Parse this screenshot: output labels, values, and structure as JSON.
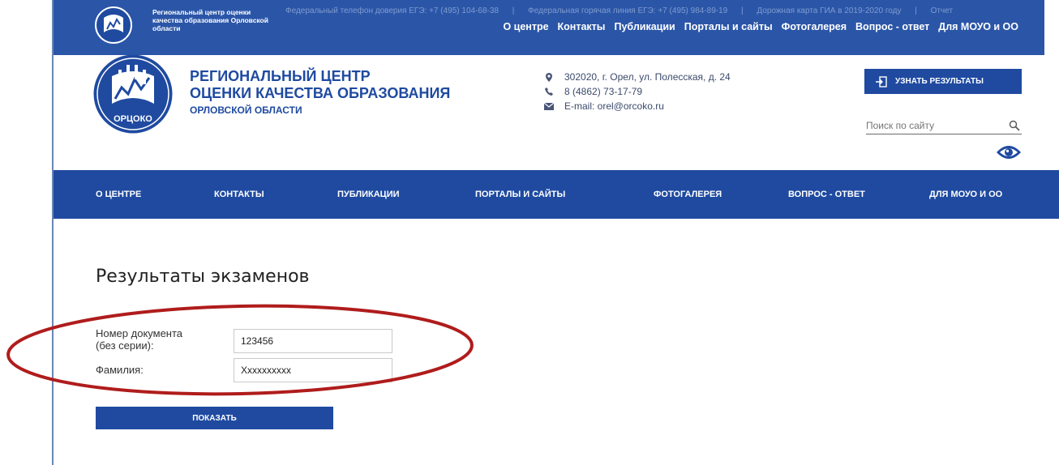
{
  "topbar": {
    "mini_title": "Региональный центр оценки качества образования Орловской области",
    "ticker": [
      "Федеральный телефон доверия ЕГЭ: +7 (495) 104-68-38",
      "|",
      "Федеральная горячая линия ЕГЭ: +7 (495) 984-89-19",
      "|",
      "Дорожная карта ГИА в 2019-2020 году",
      "|",
      "Отчет"
    ],
    "links": [
      "О центре",
      "Контакты",
      "Публикации",
      "Порталы и сайты",
      "Фотогалерея",
      "Вопрос - ответ",
      "Для МОУО и ОО"
    ]
  },
  "header": {
    "logo_text": "ОРЦОКО",
    "org_line1": "РЕГИОНАЛЬНЫЙ ЦЕНТР",
    "org_line2": "ОЦЕНКИ КАЧЕСТВА ОБРАЗОВАНИЯ",
    "org_line3": "ОРЛОВСКОЙ ОБЛАСТИ",
    "address": "302020, г. Орел, ул. Полесская, д. 24",
    "phone": "8 (4862) 73-17-79",
    "email": "E-mail: orel@orcoko.ru",
    "result_button": "УЗНАТЬ РЕЗУЛЬТАТЫ",
    "search_placeholder": "Поиск по сайту"
  },
  "nav": [
    "О ЦЕНТРЕ",
    "КОНТАКТЫ",
    "ПУБЛИКАЦИИ",
    "ПОРТАЛЫ И САЙТЫ",
    "ФОТОГАЛЕРЕЯ",
    "ВОПРОС - ОТВЕТ",
    "ДЛЯ МОУО И ОО"
  ],
  "form": {
    "title": "Результаты экзаменов",
    "doc_label_1": "Номер документа",
    "doc_label_2": "(без серии):",
    "doc_value": "123456",
    "surname_label": "Фамилия:",
    "surname_value": "Xxxxxxxxxx",
    "submit": "ПОКАЗАТЬ"
  },
  "colors": {
    "brand": "#1f4aa0",
    "top_strip": "#2b56a8",
    "annotation": "#b01c1c"
  }
}
